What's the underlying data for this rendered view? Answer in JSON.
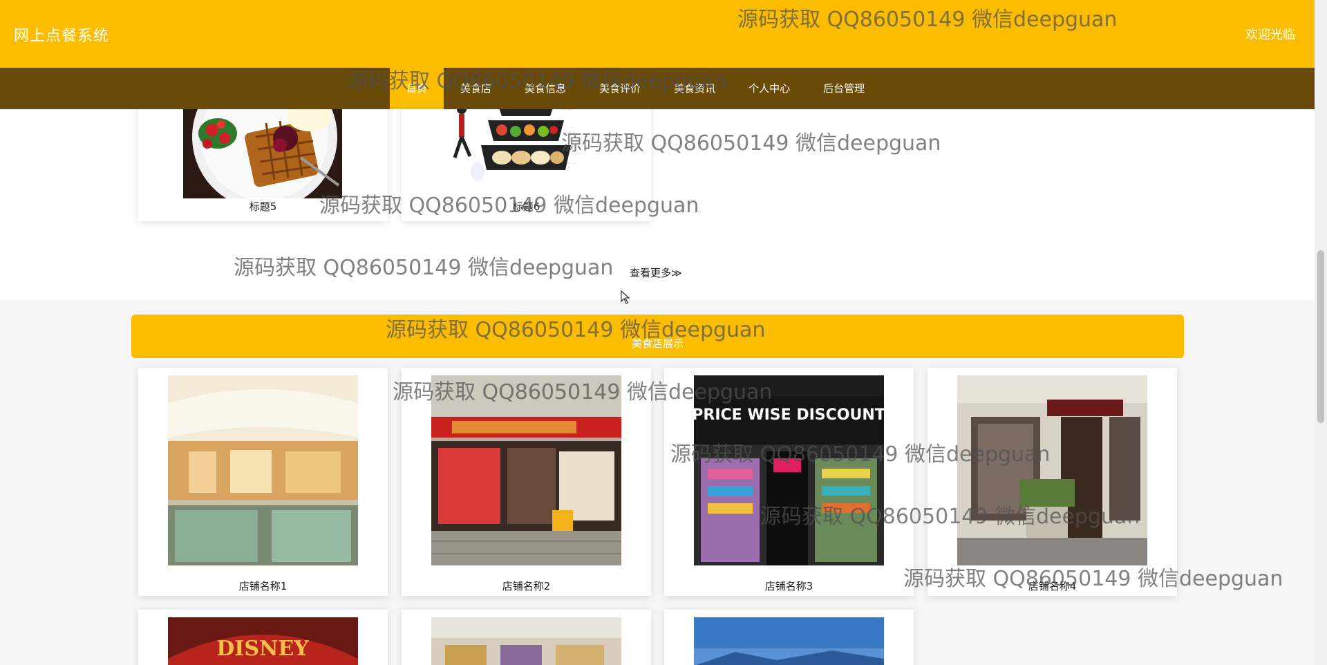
{
  "header": {
    "site_title": "网上点餐系统",
    "welcome": "欢迎光临"
  },
  "nav": {
    "items": [
      {
        "label": "首页",
        "active": true
      },
      {
        "label": "美食店",
        "active": false
      },
      {
        "label": "美食信息",
        "active": false
      },
      {
        "label": "美食评价",
        "active": false
      },
      {
        "label": "美食资讯",
        "active": false
      },
      {
        "label": "个人中心",
        "active": false
      },
      {
        "label": "后台管理",
        "active": false
      }
    ]
  },
  "food_section": {
    "cards": [
      {
        "title": "标题5"
      },
      {
        "title": "标题6"
      }
    ],
    "more_label": "查看更多≫"
  },
  "shop_section": {
    "title": "美食店展示",
    "cards": [
      {
        "title": "店铺名称1"
      },
      {
        "title": "店铺名称2"
      },
      {
        "title": "店铺名称3"
      },
      {
        "title": "店铺名称4"
      },
      {
        "title": ""
      },
      {
        "title": ""
      },
      {
        "title": ""
      }
    ]
  },
  "watermark_text": "源码获取 QQ86050149 微信deepguan",
  "colors": {
    "primary": "#fcbd00",
    "nav_bg": "#6a4a08",
    "section_bg": "#f6f6f6"
  }
}
